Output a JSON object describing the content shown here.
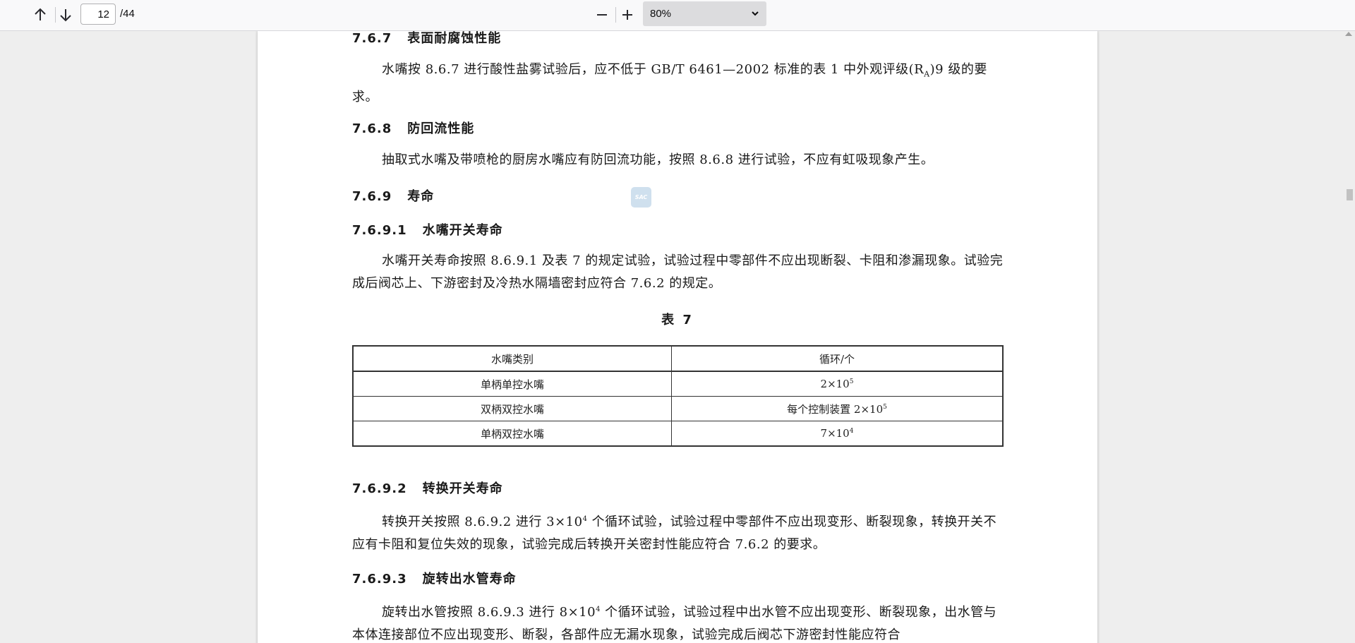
{
  "toolbar": {
    "page_number": "12",
    "page_total": "/44",
    "zoom": "80%",
    "icons": [
      "arrow-up-icon",
      "arrow-down-icon",
      "zoom-out-icon",
      "zoom-in-icon",
      "chevron-down-icon"
    ]
  },
  "document": {
    "s767": {
      "num": "7.6.7",
      "title": "表面耐腐蚀性能"
    },
    "p767": "水嘴按 8.6.7 进行酸性盐雾试验后，应不低于 GB/T 6461—2002 标准的表 1 中外观评级(R",
    "p767_sub": "A",
    "p767_end": ")9 级的要求。",
    "s768": {
      "num": "7.6.8",
      "title": "防回流性能"
    },
    "p768": "抽取式水嘴及带喷枪的厨房水嘴应有防回流功能，按照 8.6.8 进行试验，不应有虹吸现象产生。",
    "s769": {
      "num": "7.6.9",
      "title": "寿命"
    },
    "watermark": "SAC",
    "s7691": {
      "num": "7.6.9.1",
      "title": "水嘴开关寿命"
    },
    "p7691": "水嘴开关寿命按照 8.6.9.1 及表 7 的规定试验，试验过程中零部件不应出现断裂、卡阻和渗漏现象。试验完成后阀芯上、下游密封及冷热水隔墙密封应符合 7.6.2 的规定。",
    "table_caption": "表 7",
    "table": {
      "headers": [
        "水嘴类别",
        "循环/个"
      ],
      "rows": [
        {
          "type": "单柄单控水嘴",
          "cycles": "2×10",
          "exp": "5"
        },
        {
          "type": "双柄双控水嘴",
          "cycles": "每个控制装置 2×10",
          "exp": "5"
        },
        {
          "type": "单柄双控水嘴",
          "cycles": "7×10",
          "exp": "4"
        }
      ]
    },
    "s7692": {
      "num": "7.6.9.2",
      "title": "转换开关寿命"
    },
    "p7692_a": "转换开关按照 8.6.9.2 进行 3×10",
    "p7692_exp": "4",
    "p7692_b": " 个循环试验，试验过程中零部件不应出现变形、断裂现象，转换开关不应有卡阻和复位失效的现象，试验完成后转换开关密封性能应符合 7.6.2 的要求。",
    "s7693": {
      "num": "7.6.9.3",
      "title": "旋转出水管寿命"
    },
    "p7693_a": "旋转出水管按照 8.6.9.3 进行 8×10",
    "p7693_exp": "4",
    "p7693_b": " 个循环试验，试验过程中出水管不应出现变形、断裂现象，出水管与本体连接部位不应出现变形、断裂，各部件应无漏水现象，试验完成后阀芯下游密封性能应符合"
  }
}
